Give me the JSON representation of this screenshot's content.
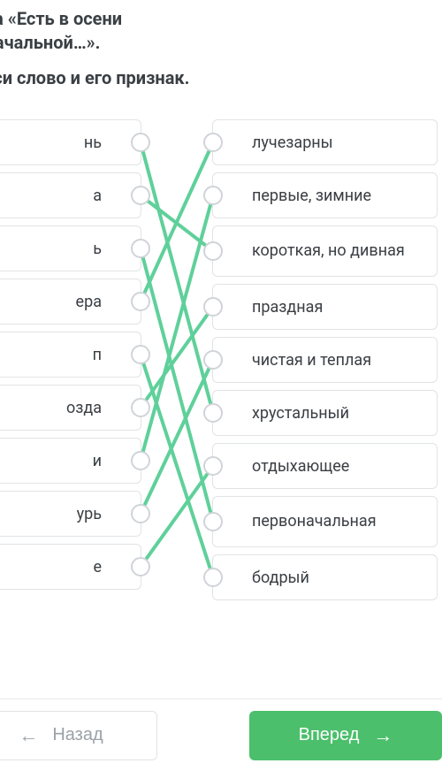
{
  "header": {
    "title_line1": "чева «Есть в осени",
    "title_line2": "воначальной…».",
    "instruction": "тнеси слово и его признак."
  },
  "left_items": [
    {
      "label": "нь"
    },
    {
      "label": "а"
    },
    {
      "label": "ь"
    },
    {
      "label": "ера"
    },
    {
      "label": "п"
    },
    {
      "label": "озда"
    },
    {
      "label": "и"
    },
    {
      "label": "урь"
    },
    {
      "label": "е"
    }
  ],
  "right_items": [
    {
      "label": "лучезарны"
    },
    {
      "label": "первые, зимние"
    },
    {
      "label": "короткая, но дивная",
      "twoLine": true
    },
    {
      "label": "праздная"
    },
    {
      "label": "чистая и теплая"
    },
    {
      "label": "хрустальный"
    },
    {
      "label": "отдыхающее"
    },
    {
      "label": "первоначальная",
      "twoLine": true
    },
    {
      "label": "бодрый"
    }
  ],
  "connections": [
    {
      "from": 0,
      "to": 5
    },
    {
      "from": 1,
      "to": 2
    },
    {
      "from": 2,
      "to": 7
    },
    {
      "from": 3,
      "to": 0
    },
    {
      "from": 4,
      "to": 8
    },
    {
      "from": 5,
      "to": 3
    },
    {
      "from": 6,
      "to": 1
    },
    {
      "from": 7,
      "to": 4
    },
    {
      "from": 8,
      "to": 6
    }
  ],
  "footer": {
    "back_label": "Назад",
    "forward_label": "Вперед"
  },
  "colors": {
    "accent_green": "#4bbf6b",
    "line_green": "#5fd09a",
    "text": "#3a3f44",
    "muted": "#9aa1a8",
    "border": "#e0e3e6"
  }
}
